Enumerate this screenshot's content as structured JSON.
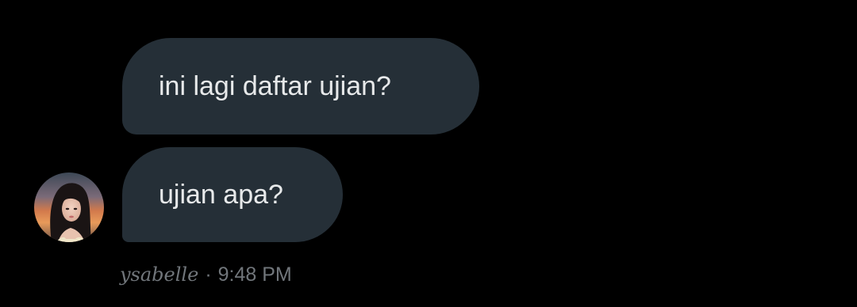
{
  "messages": [
    {
      "text": "ini lagi daftar ujian?"
    },
    {
      "text": "ujian apa?"
    }
  ],
  "sender": {
    "name": "ysabelle",
    "separator": "·",
    "time": "9:48 PM"
  },
  "colors": {
    "background": "#000000",
    "bubble": "#252f37",
    "bubble_text": "#e7e9ea",
    "meta_text": "#71767b"
  },
  "icons": {
    "avatar": "profile-photo"
  }
}
